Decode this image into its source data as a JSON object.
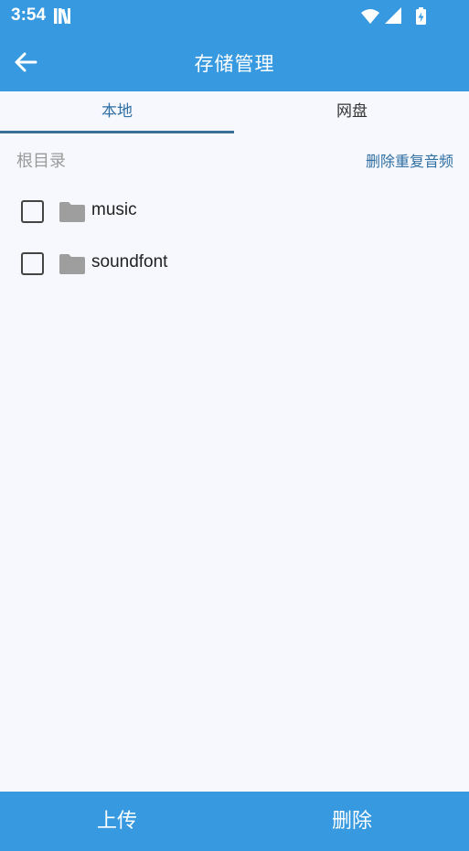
{
  "status_bar": {
    "time": "3:54",
    "icons": [
      "library-icon",
      "wifi-icon",
      "signal-icon",
      "battery-charging-icon"
    ]
  },
  "app_bar": {
    "title": "存储管理",
    "back_icon": "arrow-left-icon"
  },
  "tabs": [
    {
      "label": "本地",
      "selected": true
    },
    {
      "label": "网盘",
      "selected": false
    }
  ],
  "path": {
    "label": "根目录",
    "action_label": "删除重复音频"
  },
  "files": [
    {
      "name": "music",
      "type": "folder",
      "checked": false
    },
    {
      "name": "soundfont",
      "type": "folder",
      "checked": false
    }
  ],
  "bottom_bar": {
    "upload_label": "上传",
    "delete_label": "删除"
  },
  "colors": {
    "primary": "#3799df",
    "tab_selected_text": "#2f6fa3",
    "tab_indicator": "#3b6f98",
    "background": "#f7f8fd",
    "folder_icon": "#9e9e9e"
  }
}
